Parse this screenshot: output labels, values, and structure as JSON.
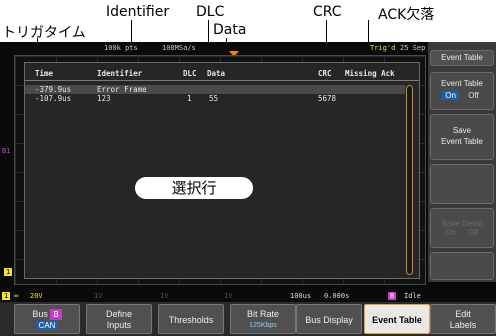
{
  "annotations": {
    "identifier": "Identifier",
    "dlc": "DLC",
    "crc": "CRC",
    "ack_missing": "ACK欠落",
    "trigger_time": "トリガタイム",
    "data": "Data",
    "selected_row": "選択行"
  },
  "topbar": {
    "pts": "100k pts",
    "sample_rate": "100MSa/s",
    "trig_status": "Trig'd",
    "date": "25 Sep"
  },
  "event_table": {
    "headers": {
      "time": "Time",
      "identifier": "Identifier",
      "dlc": "DLC",
      "data": "Data",
      "crc": "CRC",
      "missing_ack": "Missing Ack"
    },
    "rows": [
      {
        "time": "-379.9us",
        "identifier": "Error Frame",
        "dlc": "",
        "data": "",
        "crc": ""
      },
      {
        "time": "-107.9us",
        "identifier": "123",
        "dlc": "1",
        "data": "55",
        "crc": "5678"
      }
    ]
  },
  "side_menu": {
    "title": "Event Table",
    "event_table_label": "Event Table",
    "on": "On",
    "off": "Off",
    "save_line1": "Save",
    "save_line2": "Event Table",
    "goto_label": "Save Detail",
    "goto_on": "On",
    "goto_off": "Off"
  },
  "status": {
    "ch1": "20V",
    "ch2": "1V",
    "ch3": "1V",
    "ch4": "1V",
    "timebase": "100us",
    "position": "0.000s",
    "bus_badge": "B",
    "bus_status": "Idle"
  },
  "bottom_keys": {
    "bus": "Bus",
    "bus_badge": "B",
    "bus_type": "CAN",
    "define1": "Define",
    "define2": "Inputs",
    "thresholds": "Thresholds",
    "bitrate": "Bit Rate",
    "bitrate_value": "125Kbps",
    "bus_display": "Bus Display",
    "event_table": "Event Table",
    "edit1": "Edit",
    "edit2": "Labels"
  },
  "channel_markers": {
    "b1": "B1",
    "one": "1"
  },
  "colors": {
    "ch1": "#f0e040",
    "bus": "#c040c0",
    "on_toggle": "#1e5fa8",
    "active_key_border": "#e8a040"
  }
}
